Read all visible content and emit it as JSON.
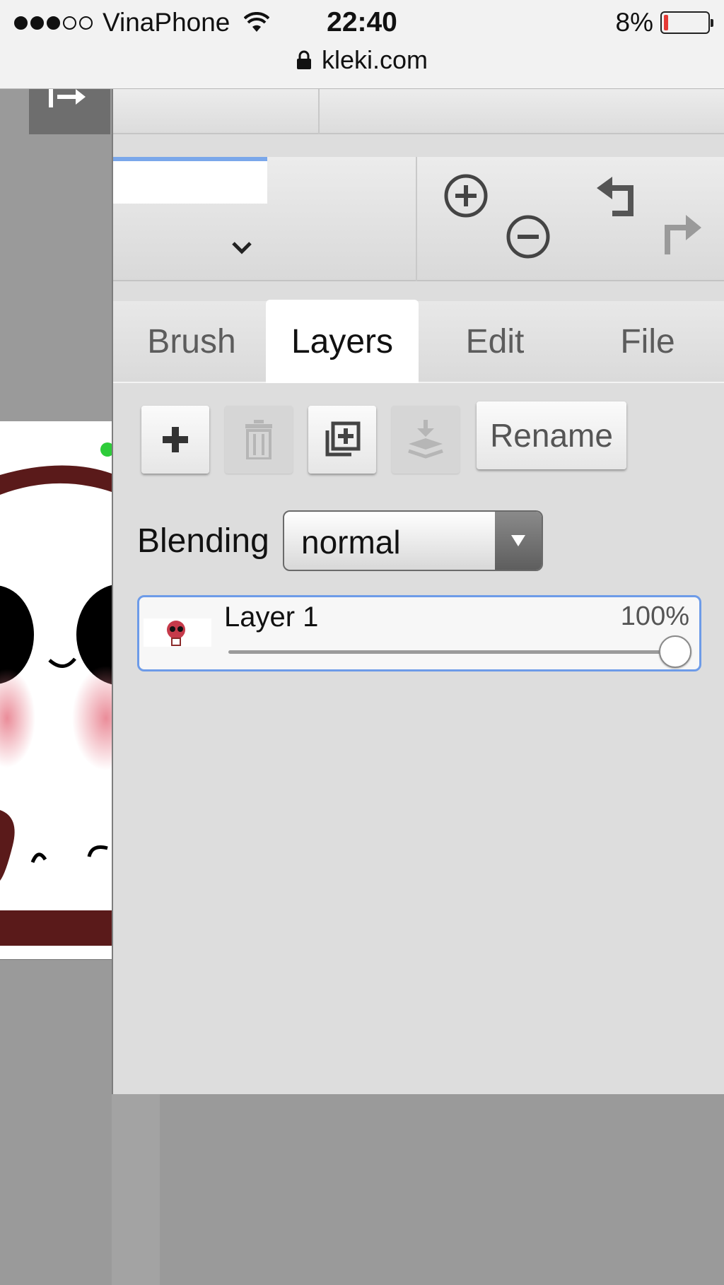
{
  "status_bar": {
    "carrier": "VinaPhone",
    "time": "22:40",
    "battery_percent": "8%",
    "battery_level": 0.08,
    "url": "kleki.com",
    "signal_bars_filled": 3,
    "signal_bars_total": 5
  },
  "canvas": {
    "collapse_icon": "collapse-panel-icon"
  },
  "toolbar": {
    "zoom_in_icon": "zoom-in-icon",
    "zoom_out_icon": "zoom-out-icon",
    "undo_icon": "undo-icon",
    "redo_icon": "redo-icon",
    "brush_dropdown_icon": "chevron-down-icon"
  },
  "tabs": [
    {
      "label": "Brush",
      "active": false
    },
    {
      "label": "Layers",
      "active": true
    },
    {
      "label": "Edit",
      "active": false
    },
    {
      "label": "File",
      "active": false
    }
  ],
  "layer_actions": {
    "add_icon": "plus-icon",
    "delete_icon": "trash-icon",
    "duplicate_icon": "duplicate-icon",
    "merge_icon": "merge-down-icon",
    "rename_label": "Rename"
  },
  "blending": {
    "label": "Blending",
    "value": "normal"
  },
  "layers": [
    {
      "name": "Layer 1",
      "opacity_label": "100%",
      "opacity": 1.0,
      "selected": true
    }
  ],
  "colors": {
    "accent": "#7aa7ea",
    "panel_bg": "#dddddd",
    "battery_low": "#e53935"
  }
}
